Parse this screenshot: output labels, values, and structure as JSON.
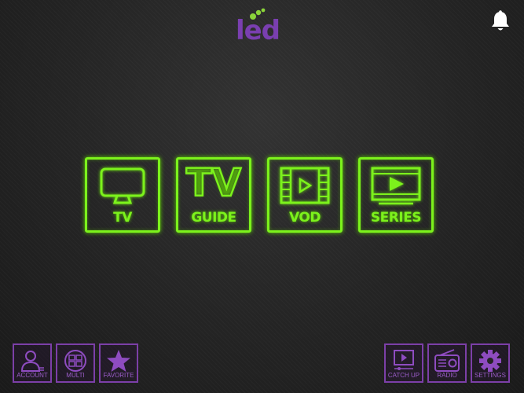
{
  "brand": {
    "logo_text": "led"
  },
  "tiles": [
    {
      "label": "TV",
      "icon": "tv-icon"
    },
    {
      "label": "GUIDE",
      "big_text": "TV",
      "icon": "tv-guide-icon"
    },
    {
      "label": "VOD",
      "icon": "film-play-icon"
    },
    {
      "label": "SERIES",
      "icon": "series-play-icon"
    }
  ],
  "bottom_left": [
    {
      "label": "ACCOUNT",
      "icon": "account-icon"
    },
    {
      "label": "MULTI",
      "icon": "multi-screen-icon"
    },
    {
      "label": "FAVORITE",
      "icon": "star-icon"
    }
  ],
  "bottom_right": [
    {
      "label": "CATCH UP",
      "icon": "catch-up-icon"
    },
    {
      "label": "RADIO",
      "icon": "radio-icon"
    },
    {
      "label": "SETTINGS",
      "icon": "gear-icon"
    }
  ],
  "colors": {
    "neon_green": "#7cf21c",
    "purple": "#7c3fa8",
    "logo_green": "#8bd43a"
  }
}
